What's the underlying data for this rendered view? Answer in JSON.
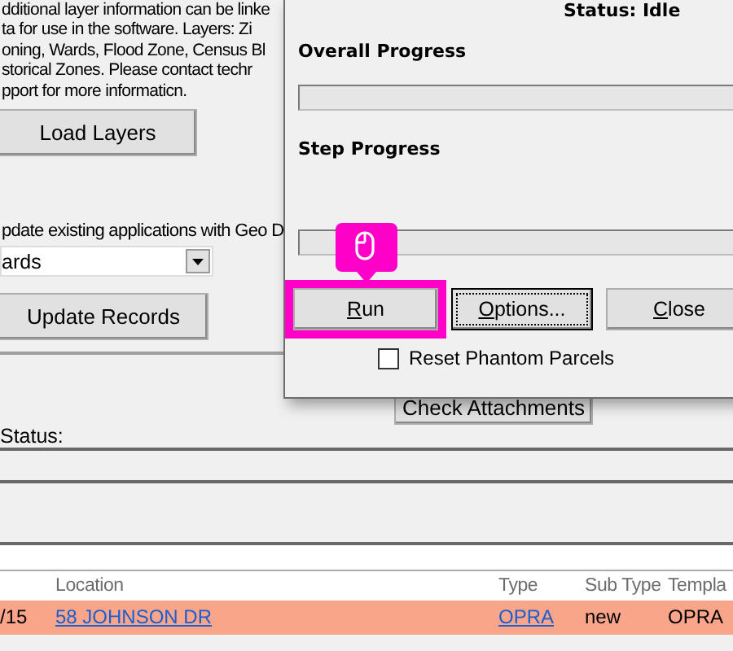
{
  "background": {
    "description_lines": [
      "dditional layer information can be linke",
      "ta for use in the software.  Layers: Zi",
      "oning, Wards, Flood Zone, Census Bl",
      "storical Zones.  Please contact techr",
      "pport for more informaticn."
    ],
    "load_button": "Load Layers",
    "update_label": "pdate existing applications with Geo D",
    "dropdown_value": "ards",
    "update_button": "Update Records",
    "attachments_button": "Check Attachments",
    "status_label": "Status:",
    "table": {
      "columns": [
        {},
        {
          "label": "Location"
        },
        {
          "label": "Type"
        },
        {
          "label": "Sub Type"
        },
        {
          "label": "Templa"
        }
      ],
      "rows": [
        {
          "highlighted": true,
          "cells": [
            {
              "text": "/15",
              "kind": "text"
            },
            {
              "text": "58 JOHNSON DR",
              "kind": "link"
            },
            {
              "text": "OPRA",
              "kind": "link"
            },
            {
              "text": "new",
              "kind": "text"
            },
            {
              "text": "OPRA",
              "kind": "text"
            }
          ]
        }
      ]
    }
  },
  "dialog": {
    "status": "Status: Idle",
    "overall": {
      "label": "Overall Progress",
      "level": 0
    },
    "step": {
      "label": "Step Progress",
      "level": 0
    },
    "buttons": [
      {
        "label": "Run",
        "highlighted": true,
        "focused": false
      },
      {
        "label": "Options...",
        "highlighted": false,
        "focused": true
      },
      {
        "label": "Close",
        "highlighted": false,
        "focused": false
      }
    ],
    "checkbox": {
      "label": "Reset Phantom Parcels",
      "checked": false
    }
  }
}
